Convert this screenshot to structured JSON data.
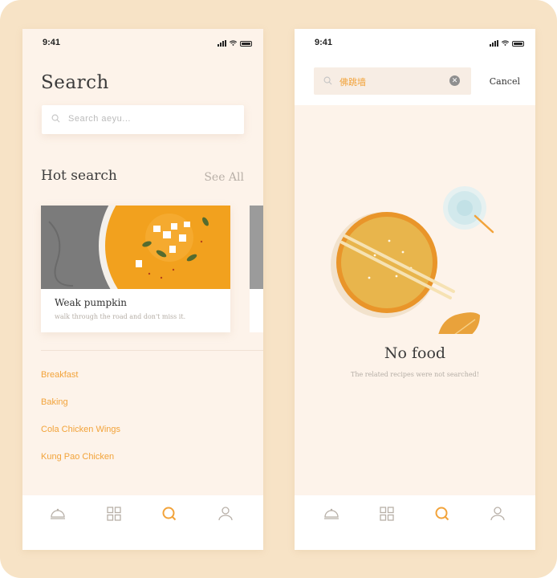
{
  "colors": {
    "accent": "#f2a33a",
    "frame": "#f7e3c6",
    "screen_bg": "#fdf3ea",
    "heading": "#3b3b3b",
    "muted": "#b5aea6"
  },
  "left": {
    "status_time": "9:41",
    "title": "Search",
    "search_placeholder": "Search aeyu...",
    "hot_search_title": "Hot search",
    "see_all": "See All",
    "card": {
      "name": "Weak pumpkin",
      "description": "walk through the road and don't miss it."
    },
    "categories": [
      "Breakfast",
      "Baking",
      "Cola Chicken Wings",
      "Kung Pao Chicken"
    ],
    "tabs": [
      "home-icon",
      "grid-icon",
      "search-icon",
      "profile-icon"
    ],
    "active_tab": "search-icon"
  },
  "right": {
    "status_time": "9:41",
    "search_value": "佛跳墙",
    "cancel": "Cancel",
    "empty_title": "No food",
    "empty_subtitle": "The related recipes were not searched!",
    "tabs": [
      "home-icon",
      "grid-icon",
      "search-icon",
      "profile-icon"
    ],
    "active_tab": "search-icon"
  }
}
